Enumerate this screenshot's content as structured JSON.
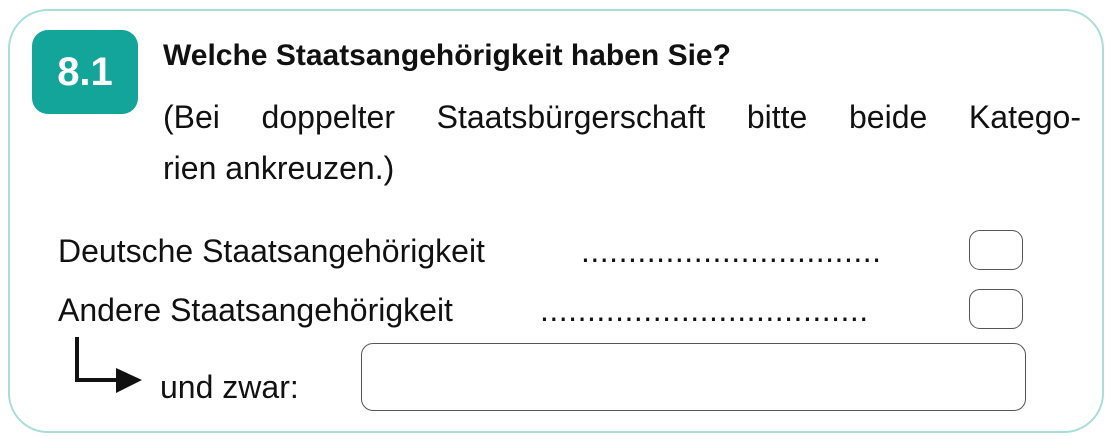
{
  "question": {
    "number": "8.1",
    "title": "Welche Staatsangehörigkeit haben Sie?",
    "hint_line1_words": [
      "(Bei",
      "doppelter",
      "Staatsbürgerschaft",
      "bitte",
      "beide",
      "Katego-"
    ],
    "hint_line2": "rien ankreuzen.)"
  },
  "options": [
    {
      "label": "Deutsche Staatsangehörigkeit",
      "dots": "................................"
    },
    {
      "label": "Andere Staatsangehörigkeit",
      "dots": "..................................."
    }
  ],
  "followup": {
    "label": "und zwar:",
    "value": ""
  },
  "colors": {
    "accent": "#13a49a",
    "card_border": "#a9ddd8"
  },
  "icons": {
    "arrow": "arrow-down-right-icon"
  }
}
